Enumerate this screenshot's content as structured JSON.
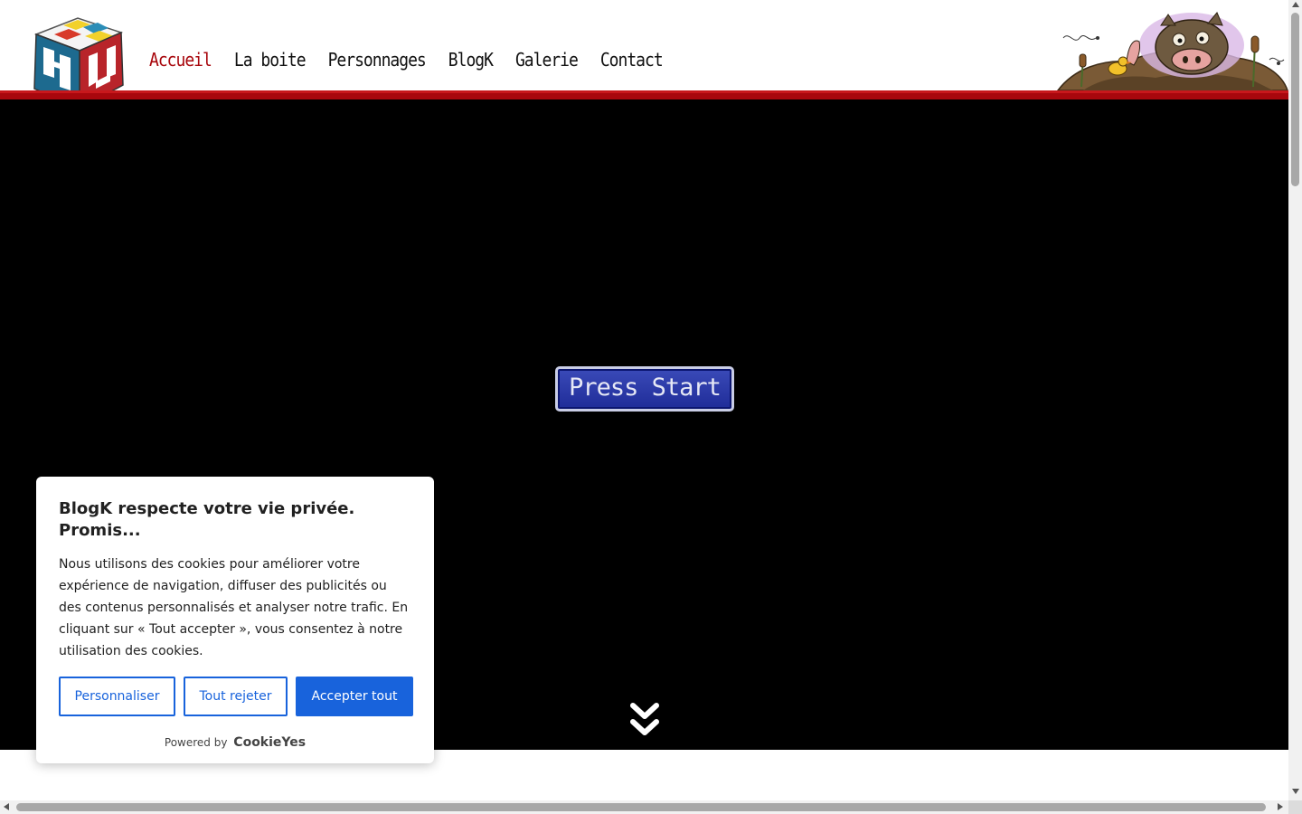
{
  "nav": {
    "items": [
      {
        "label": "Accueil",
        "active": true
      },
      {
        "label": "La boite",
        "active": false
      },
      {
        "label": "Personnages",
        "active": false
      },
      {
        "label": "BlogK",
        "active": false
      },
      {
        "label": "Galerie",
        "active": false
      },
      {
        "label": "Contact",
        "active": false
      }
    ]
  },
  "stage": {
    "press_start_label": "Press Start"
  },
  "cookie": {
    "title": "BlogK respecte votre vie privée. Promis...",
    "text": "Nous utilisons des cookies pour améliorer votre expérience de navigation, diffuser des publicités ou des contenus personnalisés et analyser notre trafic. En cliquant sur « Tout accepter », vous consentez à notre utilisation des cookies.",
    "btn_customize": "Personnaliser",
    "btn_reject": "Tout rejeter",
    "btn_accept": "Accepter tout",
    "powered_by": "Powered by",
    "powered_brand": "CookieYes"
  },
  "colors": {
    "brand_red": "#a8070d",
    "cookie_blue": "#1863dc",
    "stage_bg": "#000000",
    "press_start_blue": "#2a38a8"
  },
  "icons": {
    "logo": "cube-logo-icon",
    "mascot": "pig-in-mud-icon",
    "scroll_down": "double-chevron-down-icon"
  }
}
